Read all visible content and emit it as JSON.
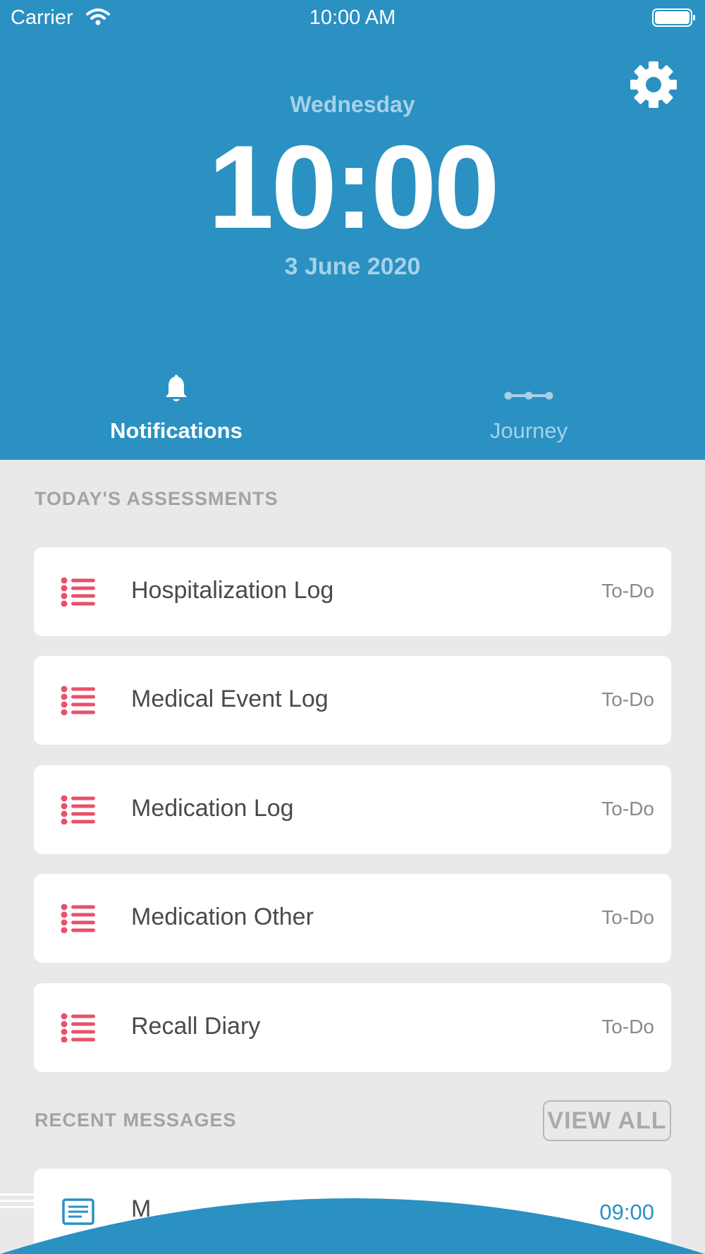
{
  "status_bar": {
    "carrier": "Carrier",
    "time": "10:00 AM"
  },
  "header": {
    "weekday": "Wednesday",
    "clock": "10:00",
    "date": "3 June 2020"
  },
  "tabs": [
    {
      "label": "Notifications",
      "icon": "bell-icon",
      "active": true
    },
    {
      "label": "Journey",
      "icon": "journey-icon",
      "active": false
    }
  ],
  "assessments": {
    "title": "TODAY'S ASSESSMENTS",
    "items": [
      {
        "label": "Hospitalization Log",
        "status": "To-Do"
      },
      {
        "label": "Medical Event Log",
        "status": "To-Do"
      },
      {
        "label": "Medication Log",
        "status": "To-Do"
      },
      {
        "label": "Medication Other",
        "status": "To-Do"
      },
      {
        "label": "Recall Diary",
        "status": "To-Do"
      }
    ]
  },
  "messages": {
    "title": "RECENT MESSAGES",
    "view_all_label": "VIEW ALL",
    "items": [
      {
        "text": "M",
        "time": "09:00"
      }
    ]
  },
  "colors": {
    "primary": "#2a91c2",
    "accent_red": "#e8516a",
    "background": "#e9e9e9"
  }
}
